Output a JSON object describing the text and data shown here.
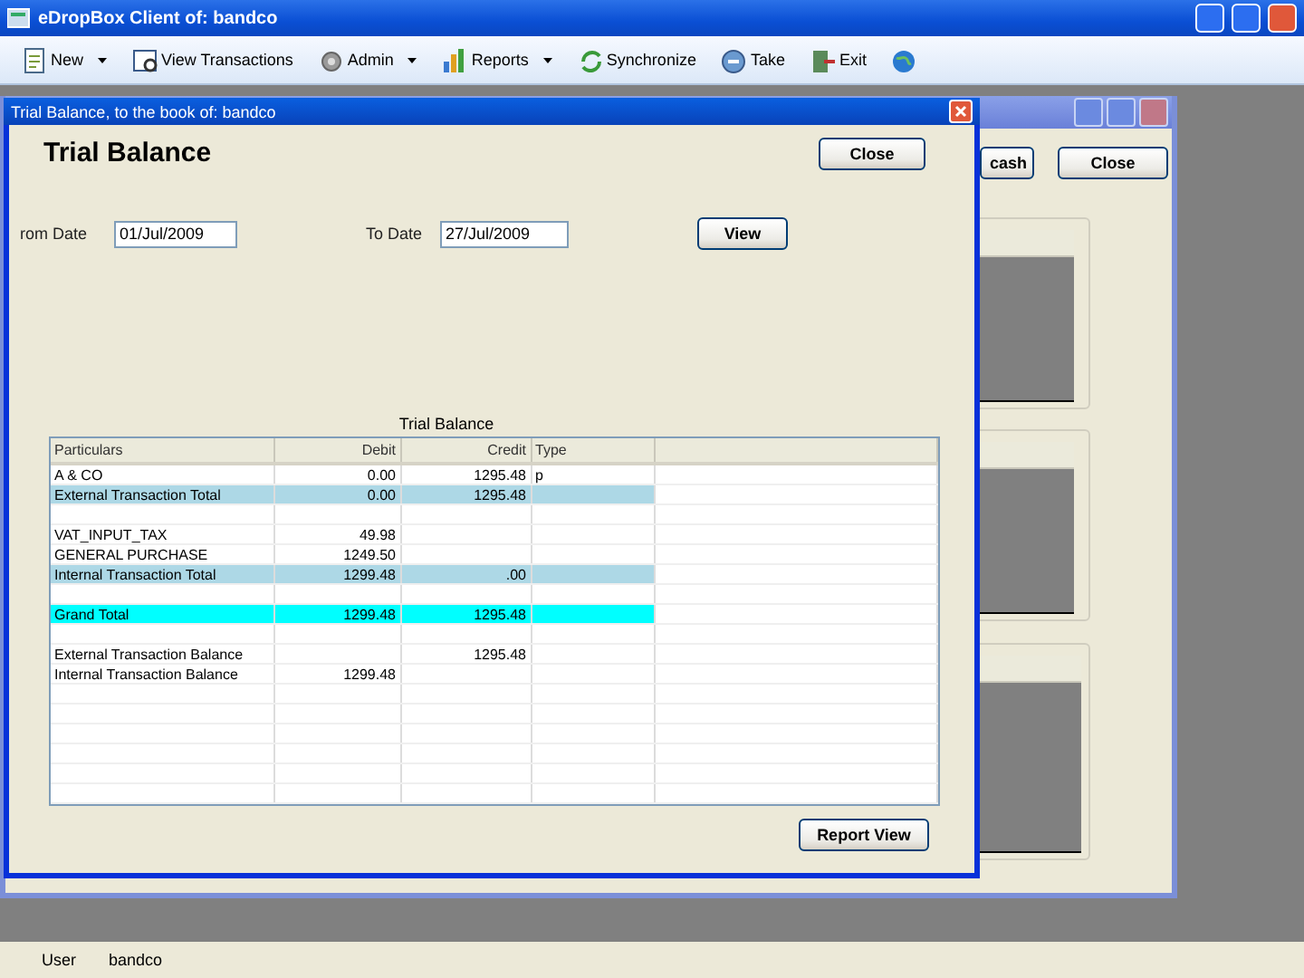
{
  "window": {
    "title": "eDropBox Client of: bandco"
  },
  "toolbar": [
    {
      "kind": "menu",
      "label": "New"
    },
    {
      "kind": "button",
      "label": "View Transactions"
    },
    {
      "kind": "menu",
      "label": "Admin"
    },
    {
      "kind": "menu",
      "label": "Reports"
    },
    {
      "kind": "button",
      "label": "Synchronize"
    },
    {
      "kind": "button",
      "label": "Take"
    },
    {
      "kind": "button",
      "label": "Exit"
    },
    {
      "kind": "icon"
    }
  ],
  "back_window": {
    "buttons": [
      "cash",
      "Close"
    ]
  },
  "dialog": {
    "title": "Trial Balance, to the book of: bandco",
    "heading": "Trial Balance",
    "close_button": "Close",
    "from_label": "rom Date",
    "from_value": "01/Jul/2009",
    "to_label": "To Date",
    "to_value": "27/Jul/2009",
    "view_button": "View",
    "table_caption": "Trial Balance",
    "columns": [
      "Particulars",
      "Debit",
      "Credit",
      "Type"
    ],
    "rows": [
      {
        "kind": "item",
        "particulars": "A & CO",
        "debit": "0.00",
        "credit": "1295.48",
        "type": "p"
      },
      {
        "kind": "total",
        "particulars": "External Transaction Total",
        "debit": "0.00",
        "credit": "1295.48",
        "type": ""
      },
      {
        "kind": "blank"
      },
      {
        "kind": "item",
        "particulars": "VAT_INPUT_TAX",
        "debit": "49.98",
        "credit": "",
        "type": ""
      },
      {
        "kind": "item",
        "particulars": "GENERAL PURCHASE",
        "debit": "1249.50",
        "credit": "",
        "type": ""
      },
      {
        "kind": "total",
        "particulars": "Internal Transaction Total",
        "debit": "1299.48",
        "credit": ".00",
        "type": ""
      },
      {
        "kind": "blank"
      },
      {
        "kind": "grand",
        "particulars": "Grand Total",
        "debit": "1299.48",
        "credit": "1295.48",
        "type": ""
      },
      {
        "kind": "blank"
      },
      {
        "kind": "item",
        "particulars": "External Transaction Balance",
        "debit": "",
        "credit": "1295.48",
        "type": ""
      },
      {
        "kind": "item",
        "particulars": "Internal Transaction Balance",
        "debit": "1299.48",
        "credit": "",
        "type": ""
      }
    ],
    "report_button": "Report View"
  },
  "status_bar": {
    "label": "User",
    "value": "bandco"
  }
}
